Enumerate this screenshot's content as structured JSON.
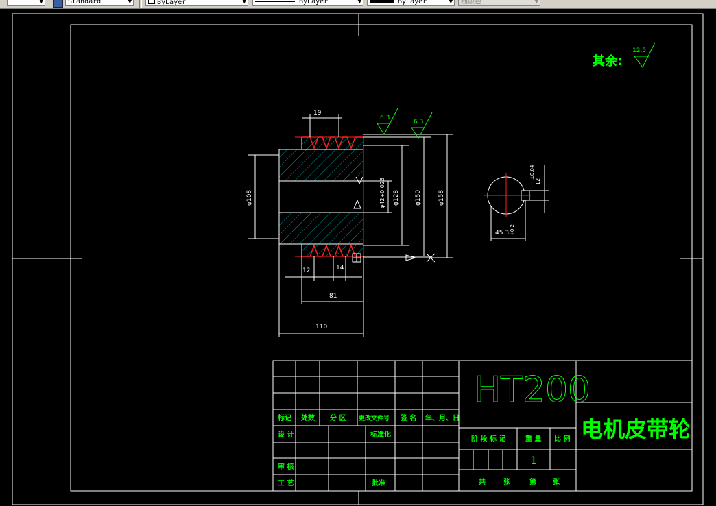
{
  "toolbar": {
    "textstyle": "Standard",
    "layer": "ByLayer",
    "linetype": "ByLayer",
    "lineweight": "ByLayer",
    "plotstyle": "随颜色"
  },
  "drawing": {
    "roughness_label": "其余:",
    "roughness_general": "12.5",
    "roughness_a": "6.3",
    "roughness_b": "6.3",
    "dims": {
      "d19": "19",
      "d108": "φ108",
      "d42": "φ42+0.025",
      "d128": "φ128",
      "d150": "φ150",
      "d158": "φ158",
      "d12": "12",
      "d14": "14",
      "d81": "81",
      "d110": "110",
      "d45": "45.3",
      "d45tol": "+0.2",
      "d12key": "12",
      "d12keytol": "±0.04"
    }
  },
  "title_block": {
    "material": "HT200",
    "part_name": "电机皮带轮",
    "row_labels": {
      "mark": "标记",
      "count": "处数",
      "zone": "分 区",
      "change_doc": "更改文件号",
      "sign": "签 名",
      "date": "年、月、日",
      "design": "设 计",
      "standardize": "标准化",
      "review": "审 核",
      "process": "工 艺",
      "approve": "批准"
    },
    "stage_mark": "阶 段 标 记",
    "weight": "重 量",
    "scale": "比 例",
    "scale_value": "1",
    "total": "共",
    "sheets1": "张",
    "page": "第",
    "sheets2": "张"
  }
}
